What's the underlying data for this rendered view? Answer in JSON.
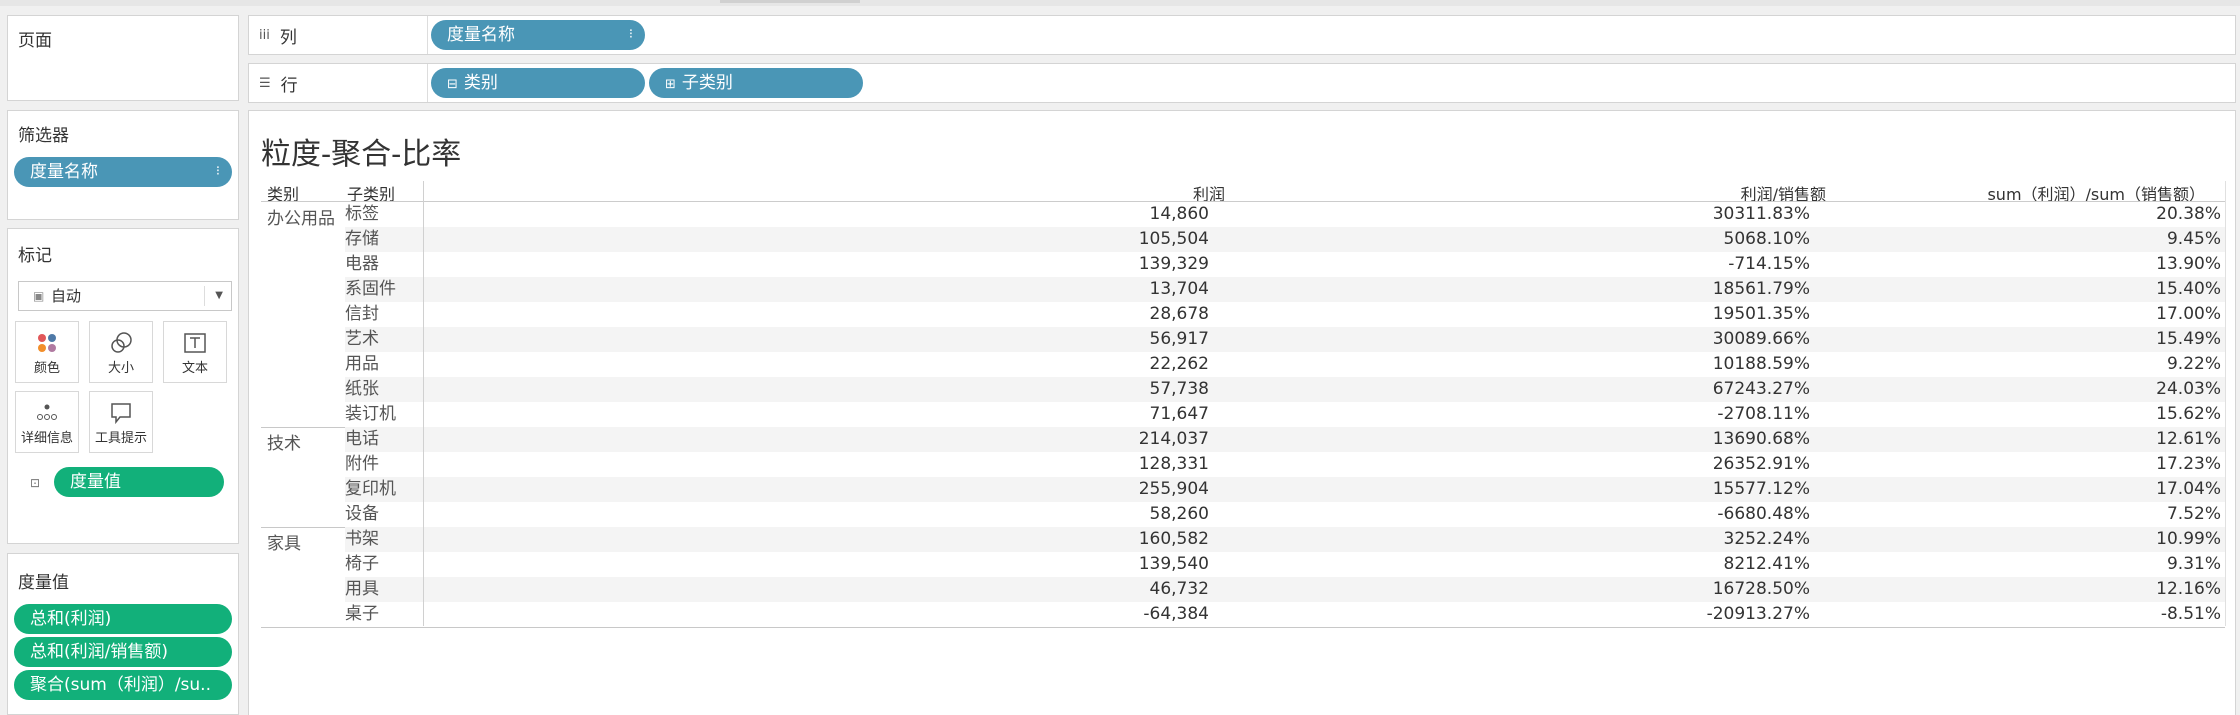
{
  "pages_panel": {
    "title": "页面"
  },
  "filters_panel": {
    "title": "筛选器",
    "pill": "度量名称"
  },
  "marks_panel": {
    "title": "标记",
    "mark_type": "自动",
    "buttons": [
      {
        "label": "颜色",
        "icon": "color-icon"
      },
      {
        "label": "大小",
        "icon": "size-icon"
      },
      {
        "label": "文本",
        "icon": "text-icon"
      },
      {
        "label": "详细信息",
        "icon": "detail-icon"
      },
      {
        "label": "工具提示",
        "icon": "tooltip-icon"
      }
    ],
    "text_pill": "度量值"
  },
  "measure_values_panel": {
    "title": "度量值",
    "pills": [
      "总和(利润)",
      "总和(利润/销售额)",
      "聚合(sum（利润）/su.."
    ]
  },
  "columns_shelf": {
    "label": "列",
    "pills": [
      "度量名称"
    ]
  },
  "rows_shelf": {
    "label": "行",
    "pills": [
      "类别",
      "子类别"
    ]
  },
  "view": {
    "title": "粒度-聚合-比率",
    "headers": {
      "category": "类别",
      "subcategory": "子类别",
      "col1": "利润",
      "col2": "利润/销售额",
      "col3": "sum（利润）/sum（销售额）"
    },
    "groups": [
      {
        "category": "办公用品",
        "rows": [
          {
            "sub": "标签",
            "v1": "14,860",
            "v2": "30311.83%",
            "v3": "20.38%"
          },
          {
            "sub": "存储",
            "v1": "105,504",
            "v2": "5068.10%",
            "v3": "9.45%"
          },
          {
            "sub": "电器",
            "v1": "139,329",
            "v2": "-714.15%",
            "v3": "13.90%"
          },
          {
            "sub": "系固件",
            "v1": "13,704",
            "v2": "18561.79%",
            "v3": "15.40%"
          },
          {
            "sub": "信封",
            "v1": "28,678",
            "v2": "19501.35%",
            "v3": "17.00%"
          },
          {
            "sub": "艺术",
            "v1": "56,917",
            "v2": "30089.66%",
            "v3": "15.49%"
          },
          {
            "sub": "用品",
            "v1": "22,262",
            "v2": "10188.59%",
            "v3": "9.22%"
          },
          {
            "sub": "纸张",
            "v1": "57,738",
            "v2": "67243.27%",
            "v3": "24.03%"
          },
          {
            "sub": "装订机",
            "v1": "71,647",
            "v2": "-2708.11%",
            "v3": "15.62%"
          }
        ]
      },
      {
        "category": "技术",
        "rows": [
          {
            "sub": "电话",
            "v1": "214,037",
            "v2": "13690.68%",
            "v3": "12.61%"
          },
          {
            "sub": "附件",
            "v1": "128,331",
            "v2": "26352.91%",
            "v3": "17.23%"
          },
          {
            "sub": "复印机",
            "v1": "255,904",
            "v2": "15577.12%",
            "v3": "17.04%"
          },
          {
            "sub": "设备",
            "v1": "58,260",
            "v2": "-6680.48%",
            "v3": "7.52%"
          }
        ]
      },
      {
        "category": "家具",
        "rows": [
          {
            "sub": "书架",
            "v1": "160,582",
            "v2": "3252.24%",
            "v3": "10.99%"
          },
          {
            "sub": "椅子",
            "v1": "139,540",
            "v2": "8212.41%",
            "v3": "9.31%"
          },
          {
            "sub": "用具",
            "v1": "46,732",
            "v2": "16728.50%",
            "v3": "12.16%"
          },
          {
            "sub": "桌子",
            "v1": "-64,384",
            "v2": "-20913.27%",
            "v3": "-8.51%"
          }
        ]
      }
    ]
  },
  "colors": {
    "dimension_pill": "#4a96b6",
    "measure_pill": "#12b07a"
  }
}
